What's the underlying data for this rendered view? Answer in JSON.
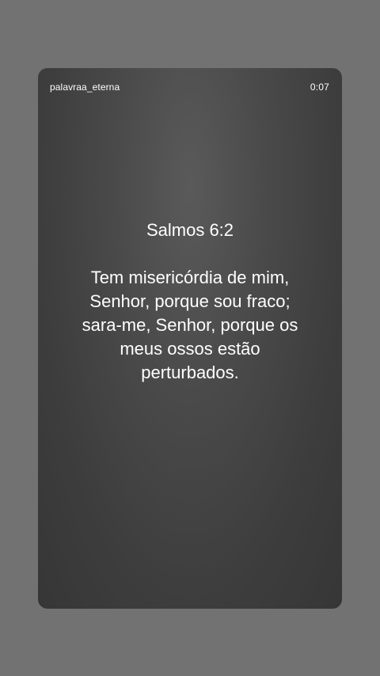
{
  "story": {
    "username": "palavraa_eterna",
    "timer": "0:07",
    "reference": "Salmos 6:2",
    "verse": "Tem misericórdia de mim, Senhor, porque sou fraco; sara-me, Senhor, porque os meus ossos estão perturbados."
  },
  "colors": {
    "page_background": "#727272",
    "card_background": "#454545",
    "text": "#ffffff"
  }
}
